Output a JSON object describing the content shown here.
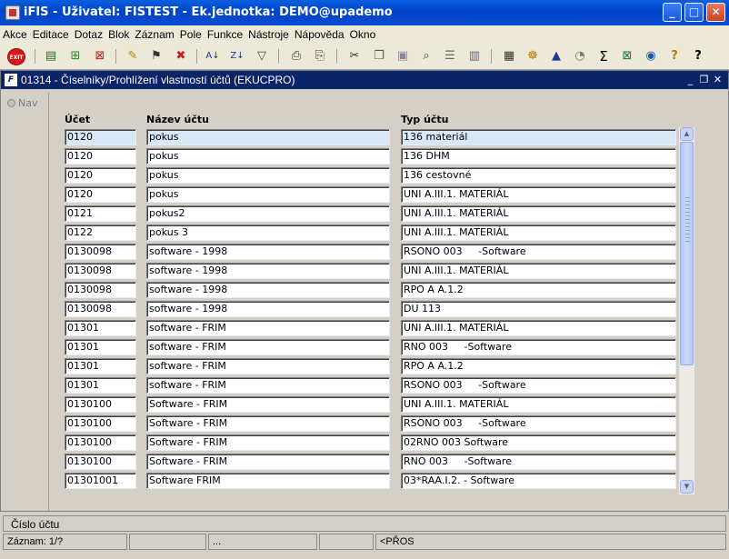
{
  "window": {
    "title": "iFIS - Uživatel: FISTEST - Ek.jednotka: DEMO@upademo",
    "minimize": "_",
    "maximize": "□",
    "close": "✕"
  },
  "menu": [
    "Akce",
    "Editace",
    "Dotaz",
    "Blok",
    "Záznam",
    "Pole",
    "Funkce",
    "Nástroje",
    "Nápověda",
    "Okno"
  ],
  "toolbar": {
    "exit_label": "EXIT",
    "icons": [
      "save-icon",
      "insert-record-icon",
      "delete-record-icon",
      "query-icon",
      "execute-query-icon",
      "cancel-query-icon",
      "sort-ascending-icon",
      "sort-descending-icon",
      "filter-icon",
      "print-icon",
      "print-preview-icon",
      "cut-icon",
      "copy-icon",
      "paste-icon",
      "find-icon",
      "list-icon",
      "columns-icon",
      "calculator-icon",
      "settings-icon",
      "chart-icon",
      "clock-icon",
      "sum-icon",
      "excel-icon",
      "browser-icon",
      "help-icon",
      "context-help-icon"
    ]
  },
  "inner_window": {
    "title": "01314 - Číselníky/Prohlížení vlastností účtů (EKUCPRO)",
    "icon_label": "F"
  },
  "nav": {
    "label": "Nav"
  },
  "columns": {
    "ucet": "Účet",
    "nazev": "Název účtu",
    "typ": "Typ účtu"
  },
  "rows": [
    {
      "ucet": "0120",
      "nazev": "pokus",
      "typ": "136 materiál"
    },
    {
      "ucet": "0120",
      "nazev": "pokus",
      "typ": "136 DHM"
    },
    {
      "ucet": "0120",
      "nazev": "pokus",
      "typ": "136 cestovné"
    },
    {
      "ucet": "0120",
      "nazev": "pokus",
      "typ": "UNI A.III.1. MATERIÁL"
    },
    {
      "ucet": "0121",
      "nazev": "pokus2",
      "typ": "UNI A.III.1. MATERIÁL"
    },
    {
      "ucet": "0122",
      "nazev": "pokus 3",
      "typ": "UNI A.III.1. MATERIÁL"
    },
    {
      "ucet": "0130098",
      "nazev": "software - 1998",
      "typ": "RSONO 003     -Software"
    },
    {
      "ucet": "0130098",
      "nazev": "software - 1998",
      "typ": "UNI A.III.1. MATERIÁL"
    },
    {
      "ucet": "0130098",
      "nazev": "software - 1998",
      "typ": "RPO A A.1.2"
    },
    {
      "ucet": "0130098",
      "nazev": "software - 1998",
      "typ": "DU 113"
    },
    {
      "ucet": "01301",
      "nazev": "software - FRIM",
      "typ": "UNI A.III.1. MATERIÁL"
    },
    {
      "ucet": "01301",
      "nazev": "software - FRIM",
      "typ": "RNO 003     -Software"
    },
    {
      "ucet": "01301",
      "nazev": "software - FRIM",
      "typ": "RPO A A.1.2"
    },
    {
      "ucet": "01301",
      "nazev": "software - FRIM",
      "typ": "RSONO 003     -Software"
    },
    {
      "ucet": "0130100",
      "nazev": "Software - FRIM",
      "typ": "UNI A.III.1. MATERIÁL"
    },
    {
      "ucet": "0130100",
      "nazev": "Software - FRIM",
      "typ": "RSONO 003     -Software"
    },
    {
      "ucet": "0130100",
      "nazev": "Software - FRIM",
      "typ": "02RNO 003 Software"
    },
    {
      "ucet": "0130100",
      "nazev": "Software - FRIM",
      "typ": "RNO 003     -Software"
    },
    {
      "ucet": "01301001",
      "nazev": "Software FRIM",
      "typ": "03*RAA.I.2. - Software"
    }
  ],
  "hint": "Číslo účtu",
  "status": {
    "record": "Záznam: 1/?",
    "seg3": "...",
    "mode": "<PŘOS"
  },
  "colors": {
    "title_blue": "#0044c8",
    "inner_title_blue": "#0a246a",
    "selected_cell": "#d8e8f8"
  }
}
